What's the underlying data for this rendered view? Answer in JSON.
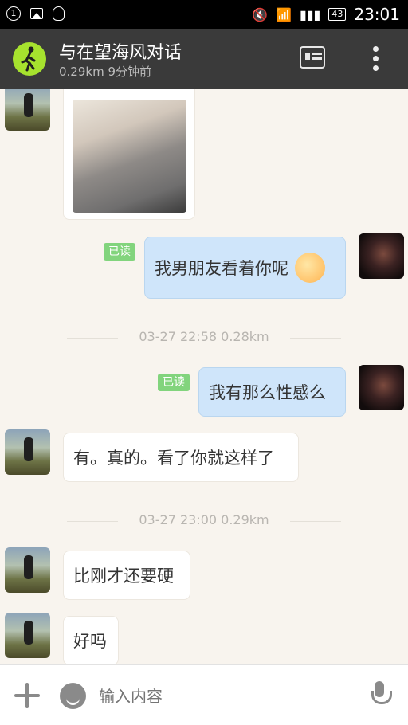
{
  "status_bar": {
    "notification_badge": "1",
    "battery": "43",
    "time": "23:01"
  },
  "header": {
    "title": "与在望海风对话",
    "subtitle": "0.29km 9分钟前"
  },
  "messages": {
    "read_label": "已读",
    "m1": "我男朋友看着你呢",
    "sep1": "03-27 22:58   0.28km",
    "m2": "我有那么性感么",
    "m3": "有。真的。看了你就这样了",
    "sep2": "03-27 23:00   0.29km",
    "m4": "比刚才还要硬",
    "m5": "好吗"
  },
  "input_bar": {
    "placeholder": "输入内容"
  }
}
